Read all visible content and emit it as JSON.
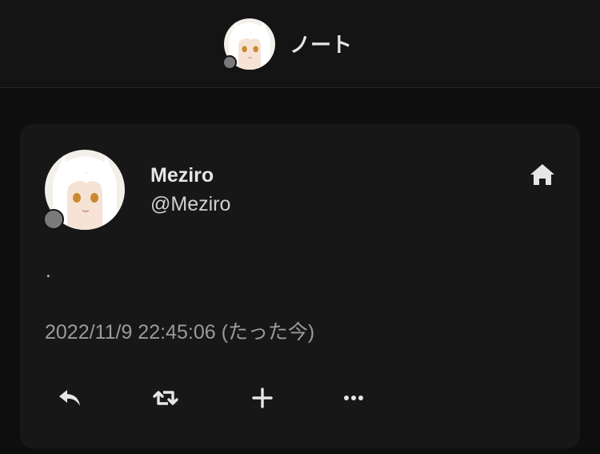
{
  "header": {
    "title": "ノート",
    "avatar_icon": "user-avatar-icon"
  },
  "note": {
    "user": {
      "name": "Meziro",
      "handle": "@Meziro"
    },
    "visibility_icon": "home-icon",
    "text": ".",
    "timestamp": "2022/11/9 22:45:06 (たった今)"
  },
  "actions": [
    {
      "icon": "reply-icon"
    },
    {
      "icon": "renote-icon"
    },
    {
      "icon": "plus-icon"
    },
    {
      "icon": "more-icon"
    }
  ],
  "colors": {
    "background": "#0e0e0e",
    "card": "#171717",
    "text": "#e6e6e6",
    "muted": "#9a9a9a",
    "status_dot": "#7a7a7a"
  }
}
